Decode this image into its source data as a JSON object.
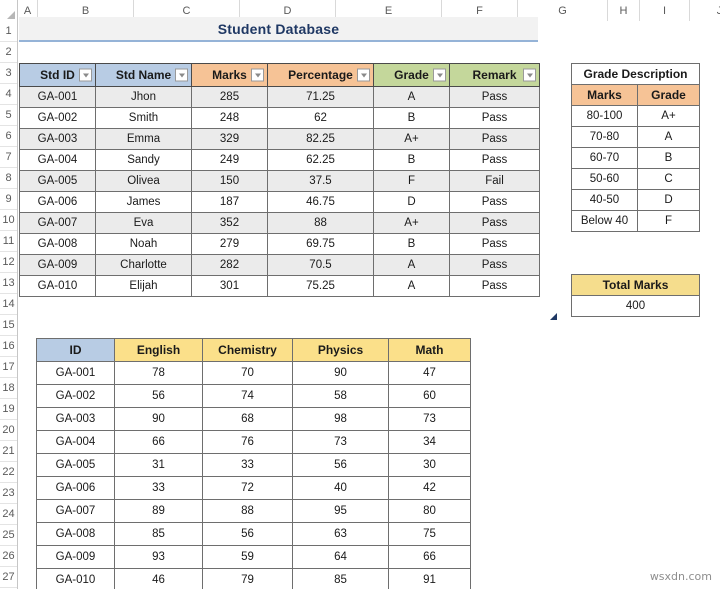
{
  "spreadsheet": {
    "column_headers": [
      "A",
      "B",
      "C",
      "D",
      "E",
      "F",
      "G",
      "H",
      "I",
      "J"
    ],
    "row_numbers": [
      "1",
      "2",
      "3",
      "4",
      "5",
      "6",
      "7",
      "8",
      "9",
      "10",
      "11",
      "12",
      "13",
      "14",
      "15",
      "16",
      "17",
      "18",
      "19",
      "20",
      "21",
      "22",
      "23",
      "24",
      "25",
      "26",
      "27"
    ],
    "watermark": "wsxdn.com"
  },
  "title": {
    "text": "Student Database"
  },
  "colors": {
    "header_blue": "#b8cce4",
    "header_orange": "#f6c396",
    "header_green": "#c4d79b",
    "header_gold": "#fbe08a",
    "total_gold": "#f5dd8d",
    "band_gray": "#ebebeb",
    "title_text": "#1f3864",
    "title_rule": "#95b3d7"
  },
  "main_table": {
    "columns": [
      {
        "label": "Std ID",
        "style": "blue",
        "filter": true
      },
      {
        "label": "Std Name",
        "style": "blue",
        "filter": true
      },
      {
        "label": "Marks",
        "style": "orange",
        "filter": true
      },
      {
        "label": "Percentage",
        "style": "orange",
        "filter": true
      },
      {
        "label": "Grade",
        "style": "green",
        "filter": true
      },
      {
        "label": "Remark",
        "style": "green",
        "filter": true
      }
    ],
    "rows": [
      [
        "GA-001",
        "Jhon",
        "285",
        "71.25",
        "A",
        "Pass"
      ],
      [
        "GA-002",
        "Smith",
        "248",
        "62",
        "B",
        "Pass"
      ],
      [
        "GA-003",
        "Emma",
        "329",
        "82.25",
        "A+",
        "Pass"
      ],
      [
        "GA-004",
        "Sandy",
        "249",
        "62.25",
        "B",
        "Pass"
      ],
      [
        "GA-005",
        "Olivea",
        "150",
        "37.5",
        "F",
        "Fail"
      ],
      [
        "GA-006",
        "James",
        "187",
        "46.75",
        "D",
        "Pass"
      ],
      [
        "GA-007",
        "Eva",
        "352",
        "88",
        "A+",
        "Pass"
      ],
      [
        "GA-008",
        "Noah",
        "279",
        "69.75",
        "B",
        "Pass"
      ],
      [
        "GA-009",
        "Charlotte",
        "282",
        "70.5",
        "A",
        "Pass"
      ],
      [
        "GA-010",
        "Elijah",
        "301",
        "75.25",
        "A",
        "Pass"
      ]
    ]
  },
  "grade_description": {
    "title": "Grade Description",
    "headers": [
      "Marks",
      "Grade"
    ],
    "rows": [
      [
        "80-100",
        "A+"
      ],
      [
        "70-80",
        "A"
      ],
      [
        "60-70",
        "B"
      ],
      [
        "50-60",
        "C"
      ],
      [
        "40-50",
        "D"
      ],
      [
        "Below 40",
        "F"
      ]
    ]
  },
  "total_marks": {
    "label": "Total Marks",
    "value": "400"
  },
  "subject_table": {
    "headers": [
      "ID",
      "English",
      "Chemistry",
      "Physics",
      "Math"
    ],
    "rows": [
      [
        "GA-001",
        "78",
        "70",
        "90",
        "47"
      ],
      [
        "GA-002",
        "56",
        "74",
        "58",
        "60"
      ],
      [
        "GA-003",
        "90",
        "68",
        "98",
        "73"
      ],
      [
        "GA-004",
        "66",
        "76",
        "73",
        "34"
      ],
      [
        "GA-005",
        "31",
        "33",
        "56",
        "30"
      ],
      [
        "GA-006",
        "33",
        "72",
        "40",
        "42"
      ],
      [
        "GA-007",
        "89",
        "88",
        "95",
        "80"
      ],
      [
        "GA-008",
        "85",
        "56",
        "63",
        "75"
      ],
      [
        "GA-009",
        "93",
        "59",
        "64",
        "66"
      ],
      [
        "GA-010",
        "46",
        "79",
        "85",
        "91"
      ]
    ]
  }
}
